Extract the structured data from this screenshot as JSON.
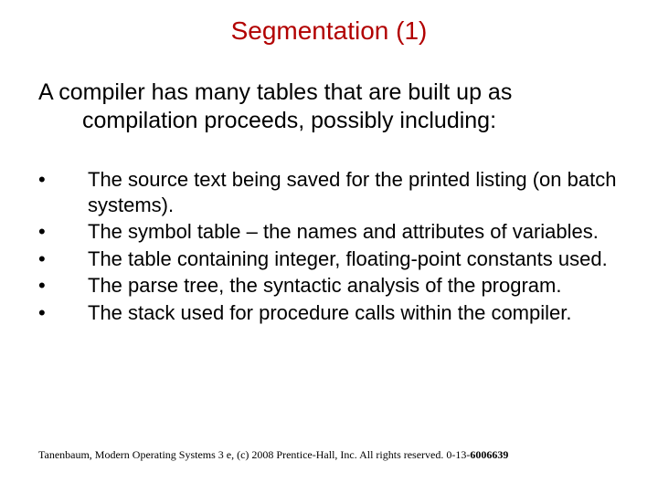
{
  "title": "Segmentation (1)",
  "intro": {
    "line1": "A compiler has many tables that are built up as",
    "line2": "compilation proceeds, possibly including:"
  },
  "bullets": [
    "The source text being saved for the printed listing (on batch systems).",
    "The symbol table – the names and attributes of variables.",
    "The table containing integer, floating-point constants used.",
    "The parse tree, the syntactic analysis of the program.",
    "The stack used for procedure calls within the compiler."
  ],
  "footer": {
    "prefix": "Tanenbaum, Modern Operating Systems 3 e, (c) 2008 Prentice-Hall, Inc. All rights reserved. 0-13-",
    "bold": "6006639"
  }
}
